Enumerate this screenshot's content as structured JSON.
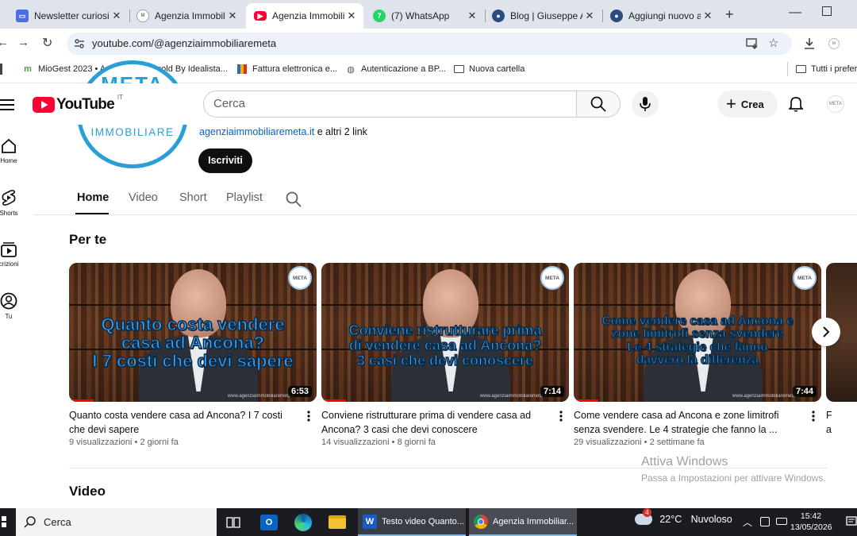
{
  "browser": {
    "tabs": [
      {
        "title": "Newsletter curiosit",
        "icon": "newsletter-favicon-icon",
        "color": "#4a6ee0"
      },
      {
        "title": "Agenzia Immobilia",
        "icon": "meta-favicon-icon",
        "color": "#9aa0a6"
      },
      {
        "title": "Agenzia Immobilia",
        "icon": "youtube-favicon-icon",
        "color": "#ff0033",
        "active": true
      },
      {
        "title": "(7) WhatsApp",
        "icon": "whatsapp-favicon-icon",
        "color": "#25d366"
      },
      {
        "title": "Blog | Giuseppe Ar",
        "icon": "blog-favicon-icon",
        "color": "#2b4c7e"
      },
      {
        "title": "Aggiungi nuovo ar",
        "icon": "wordpress-favicon-icon",
        "color": "#2b4c7e"
      }
    ],
    "url": "youtube.com/@agenziaimmobiliaremeta",
    "bookmarks": [
      {
        "label": "MioGest 2023 • Ann...",
        "icon": "miogest-icon"
      },
      {
        "label": "Regold By Idealista...",
        "icon": "regold-icon"
      },
      {
        "label": "Fattura elettronica e...",
        "icon": "fattura-icon"
      },
      {
        "label": "Autenticazione a BP...",
        "icon": "globe-icon"
      },
      {
        "label": "Nuova cartella",
        "icon": "folder-icon"
      }
    ],
    "bookmarks_all": "Tutti i prefer"
  },
  "youtube": {
    "logo_text": "YouTube",
    "country_code": "IT",
    "search_placeholder": "Cerca",
    "create_label": "Crea",
    "rail": [
      {
        "label": "Home",
        "icon": "home-icon"
      },
      {
        "label": "Shorts",
        "icon": "shorts-icon"
      },
      {
        "label": "crizioni",
        "icon": "subscriptions-icon"
      },
      {
        "label": "Tu",
        "icon": "you-icon"
      }
    ],
    "channel": {
      "logo_text": "IMMOBILIARE",
      "logo_top_text": "META",
      "link": "agenziaimmobiliaremeta.it",
      "link_suffix": "e altri 2 link",
      "subscribe_label": "Iscriviti",
      "tabs": [
        "Home",
        "Video",
        "Short",
        "Playlist"
      ]
    },
    "section_for_you": "Per te",
    "section_videos": "Video",
    "videos": [
      {
        "overlay": [
          "Quanto costa vendere",
          "casa ad Ancona?",
          "I 7 costi che devi sapere"
        ],
        "duration": "6:53",
        "title": "Quanto costa vendere casa ad Ancona? I 7 costi che devi sapere",
        "views": "9 visualizzazioni",
        "age": "2 giorni fa",
        "watched": 0.1
      },
      {
        "overlay": [
          "Conviene ristrutturare prima",
          "di vendere casa ad Ancona?",
          "3 casi che devi conoscere"
        ],
        "duration": "7:14",
        "title": "Conviene ristrutturare prima di vendere casa ad Ancona? 3 casi che devi conoscere",
        "views": "14 visualizzazioni",
        "age": "8 giorni fa",
        "watched": 0.1
      },
      {
        "overlay": [
          "Come vendere casa ad Ancona e",
          "zone limitrofi senza svendere",
          "Le 4 strategie che fanno",
          "davvero la differenza"
        ],
        "duration": "7:44",
        "title": "Come vendere casa ad Ancona e zone limitrofi senza svendere. Le 4 strategie che fanno la ...",
        "views": "29 visualizzazioni",
        "age": "2 settimane fa",
        "watched": 0.1
      }
    ],
    "thumb_badge": "META",
    "thumb_watermark": "www.agenziaimmobiliaremeta.it"
  },
  "windows_activation": {
    "title": "Attiva Windows",
    "subtitle": "Passa a Impostazioni per attivare Windows."
  },
  "taskbar": {
    "search_label": "Cerca",
    "apps": [
      {
        "label": "Testo video Quanto...",
        "icon": "word-icon"
      },
      {
        "label": "Agenzia Immobiliar...",
        "icon": "chrome-icon"
      }
    ],
    "weather_temp": "22°C",
    "weather_text": "Nuvoloso",
    "weather_badge": "4",
    "time": "15:42",
    "date": "13/05/2026"
  }
}
